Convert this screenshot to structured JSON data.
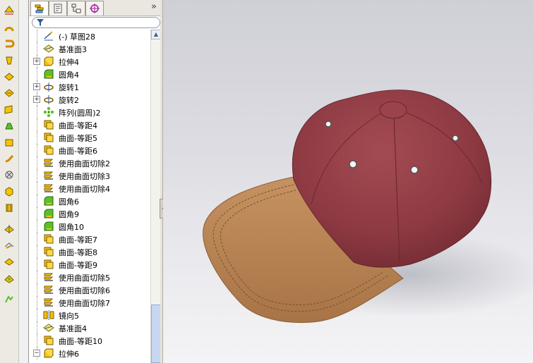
{
  "panel": {
    "expand_glyph": "»",
    "tabs": [
      {
        "icon": "feature-manager-icon",
        "active": true
      },
      {
        "icon": "property-manager-icon",
        "active": false
      },
      {
        "icon": "configuration-manager-icon",
        "active": false
      },
      {
        "icon": "dimxpert-icon",
        "active": false
      }
    ]
  },
  "tree": {
    "items": [
      {
        "label": "(-) 草图28",
        "icon": "sketch-icon",
        "expander": false
      },
      {
        "label": "基准面3",
        "icon": "plane-icon",
        "expander": false
      },
      {
        "label": "拉伸4",
        "icon": "extrude-icon",
        "expander": true
      },
      {
        "label": "圆角4",
        "icon": "fillet-icon",
        "expander": false
      },
      {
        "label": "旋转1",
        "icon": "revolve-icon",
        "expander": true
      },
      {
        "label": "旋转2",
        "icon": "revolve-icon",
        "expander": true
      },
      {
        "label": "阵列(圆周)2",
        "icon": "circular-pattern-icon",
        "expander": false
      },
      {
        "label": "曲面-等距4",
        "icon": "offset-surface-icon",
        "expander": false
      },
      {
        "label": "曲面-等距5",
        "icon": "offset-surface-icon",
        "expander": false
      },
      {
        "label": "曲面-等距6",
        "icon": "offset-surface-icon",
        "expander": false
      },
      {
        "label": "使用曲面切除2",
        "icon": "surface-cut-icon",
        "expander": false
      },
      {
        "label": "使用曲面切除3",
        "icon": "surface-cut-icon",
        "expander": false
      },
      {
        "label": "使用曲面切除4",
        "icon": "surface-cut-icon",
        "expander": false
      },
      {
        "label": "圆角6",
        "icon": "fillet-icon",
        "expander": false
      },
      {
        "label": "圆角9",
        "icon": "fillet-icon",
        "expander": false
      },
      {
        "label": "圆角10",
        "icon": "fillet-icon",
        "expander": false
      },
      {
        "label": "曲面-等距7",
        "icon": "offset-surface-icon",
        "expander": false
      },
      {
        "label": "曲面-等距8",
        "icon": "offset-surface-icon",
        "expander": false
      },
      {
        "label": "曲面-等距9",
        "icon": "offset-surface-icon",
        "expander": false
      },
      {
        "label": "使用曲面切除5",
        "icon": "surface-cut-icon",
        "expander": false
      },
      {
        "label": "使用曲面切除6",
        "icon": "surface-cut-icon",
        "expander": false
      },
      {
        "label": "使用曲面切除7",
        "icon": "surface-cut-icon",
        "expander": false
      },
      {
        "label": "镜向5",
        "icon": "mirror-icon",
        "expander": false
      },
      {
        "label": "基准面4",
        "icon": "plane-icon",
        "expander": false
      },
      {
        "label": "曲面-等距10",
        "icon": "offset-surface-icon",
        "expander": false
      },
      {
        "label": "拉伸6",
        "icon": "extrude-icon",
        "expander": "minus"
      }
    ]
  },
  "toolbar": {
    "tools": [
      "extruded-boss-icon",
      "revolved-boss-icon",
      "swept-boss-icon",
      "lofted-boss-icon",
      "fillet-tool-icon",
      "chamfer-tool-icon",
      "plane-tool-icon",
      "draft-tool-icon",
      "shell-tool-icon",
      "wrap-tool-icon",
      "hole-wizard-icon",
      "dome-tool-icon",
      "rib-tool-icon",
      "reference-geometry-icon",
      "linear-pattern-icon",
      "mirror-tool-icon",
      "curves-icon",
      "instant3d-icon"
    ]
  },
  "colors": {
    "crown": "#8e3a42",
    "brim": "#b98552",
    "feature_yellow": "#f5c400",
    "fillet_green": "#5fbf2a",
    "accent_blue": "#2c5aa0"
  }
}
